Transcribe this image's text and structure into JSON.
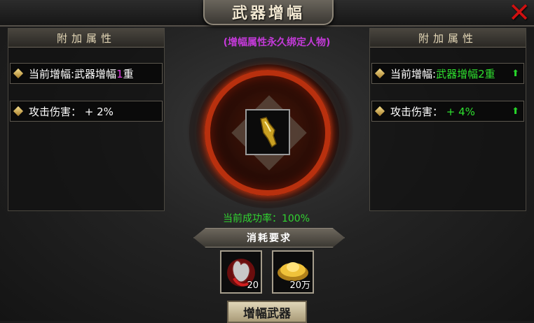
{
  "title": "武器增幅",
  "close_icon": "close-x-icon",
  "left_panel": {
    "header": "附加属性",
    "rows": [
      {
        "prefix": "当前增幅:武器增幅",
        "level": "1",
        "suffix": "重"
      },
      {
        "label": "攻击伤害：",
        "value": "+ 2%"
      }
    ]
  },
  "right_panel": {
    "header": "附加属性",
    "rows": [
      {
        "prefix": "当前增幅:",
        "value": "武器增幅2重",
        "arrow": "up-arrow-icon"
      },
      {
        "label": "攻击伤害：",
        "value": "+ 4%",
        "arrow": "up-arrow-icon"
      }
    ]
  },
  "center": {
    "bind_note": "(增幅属性永久绑定人物)",
    "success_rate": "当前成功率：100%",
    "cost_title": "消耗要求",
    "costs": [
      {
        "icon": "heart-item-icon",
        "count": "20"
      },
      {
        "icon": "gold-ingot-icon",
        "count": "20万"
      }
    ],
    "action_label": "增幅武器"
  },
  "colors": {
    "highlight_pink": "#e040e0",
    "green": "#2ee02e",
    "note_purple": "#c33ad8",
    "ring_red": "#b8300e"
  }
}
